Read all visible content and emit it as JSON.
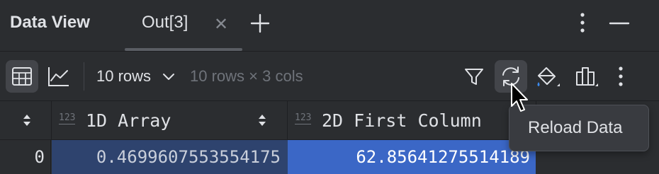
{
  "panel": {
    "title": "Data View"
  },
  "tabs": [
    {
      "label": "Out[3]",
      "active": true
    }
  ],
  "header_actions": {
    "add_icon": "plus-icon",
    "more_icon": "kebab-icon",
    "minimize_icon": "minus-icon"
  },
  "toolbar": {
    "view_table_icon": "table-icon",
    "view_chart_icon": "line-chart-icon",
    "rows_select": "10 rows",
    "dimensions": "10 rows × 3 cols",
    "filter_icon": "filter-icon",
    "reload_icon": "reload-icon",
    "paint_icon": "paint-bucket-icon",
    "columns_icon": "columns-icon",
    "more_icon": "kebab-icon"
  },
  "table": {
    "columns": [
      {
        "type_badge": "123",
        "name": "1D Array"
      },
      {
        "type_badge": "123",
        "name": "2D First Column"
      }
    ],
    "rows": [
      {
        "index": "0",
        "cells": [
          "0.4699607553554175",
          "62.85641275514189"
        ]
      }
    ]
  },
  "tooltip": {
    "text": "Reload Data"
  },
  "colors": {
    "background": "#2b2d30",
    "selected_cell": "#3b67c6",
    "highlighted_column": "#2e436e",
    "tooltip_bg": "#393b40"
  }
}
